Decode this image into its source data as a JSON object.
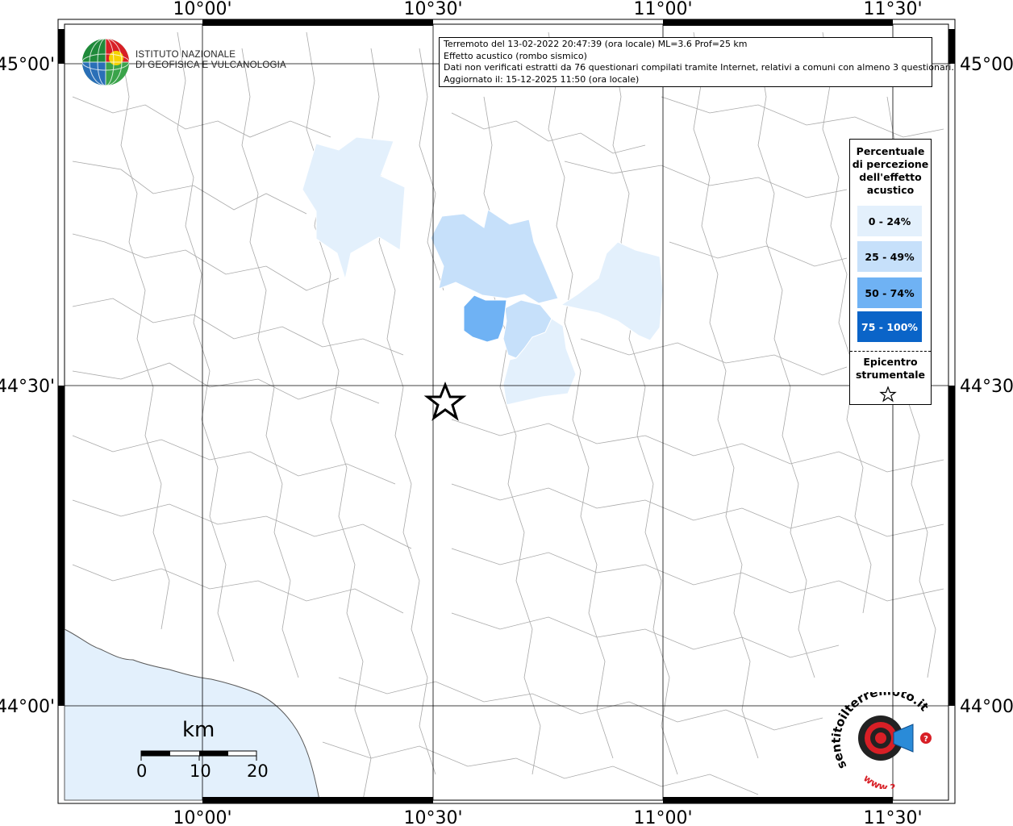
{
  "info": {
    "line1": "Terremoto del 13-02-2022 20:47:39 (ora locale) ML=3.6 Prof=25 km",
    "line2": "Effetto acustico (rombo sismico)",
    "line3": "Dati non verificati estratti da 76 questionari compilati tramite Internet, relativi a comuni con almeno 3 questionari.",
    "line4": "Aggiornato il: 15-12-2025 11:50 (ora locale)"
  },
  "logo": {
    "line1": "ISTITUTO NAZIONALE",
    "line2": "DI GEOFISICA E VULCANOLOGIA"
  },
  "axes": {
    "top": [
      "10°00'",
      "10°30'",
      "11°00'",
      "11°30'"
    ],
    "bottom": [
      "10°00'",
      "10°30'",
      "11°00'",
      "11°30'"
    ],
    "left": [
      "45°00'",
      "44°30'",
      "44°00'"
    ],
    "right": [
      "45°00'",
      "44°30'",
      "44°00'"
    ]
  },
  "legend": {
    "title_lines": [
      "Percentuale",
      "di percezione",
      "dell'effetto",
      "acustico"
    ],
    "items": [
      {
        "label": "0 - 24%",
        "color": "#e3f0fc",
        "text_color": "#000000"
      },
      {
        "label": "25 - 49%",
        "color": "#c6e0fa",
        "text_color": "#000000"
      },
      {
        "label": "50 - 74%",
        "color": "#6fb2f4",
        "text_color": "#000000"
      },
      {
        "label": "75 - 100%",
        "color": "#0a64c8",
        "text_color": "#ffffff"
      }
    ],
    "epicenter_lines": [
      "Epicentro",
      "strumentale"
    ],
    "epicenter_icon": "star-outline-icon"
  },
  "scale": {
    "title": "km",
    "labels": [
      "0",
      "10",
      "20"
    ]
  },
  "badge": {
    "text_top": "sentitoilterremoto.it",
    "text_bottom": "www.?",
    "icon": "megaphone-icon"
  },
  "colors": {
    "sea": "#e3f0fc",
    "grid": "#000000",
    "boundaries": "#a0a0a0"
  }
}
